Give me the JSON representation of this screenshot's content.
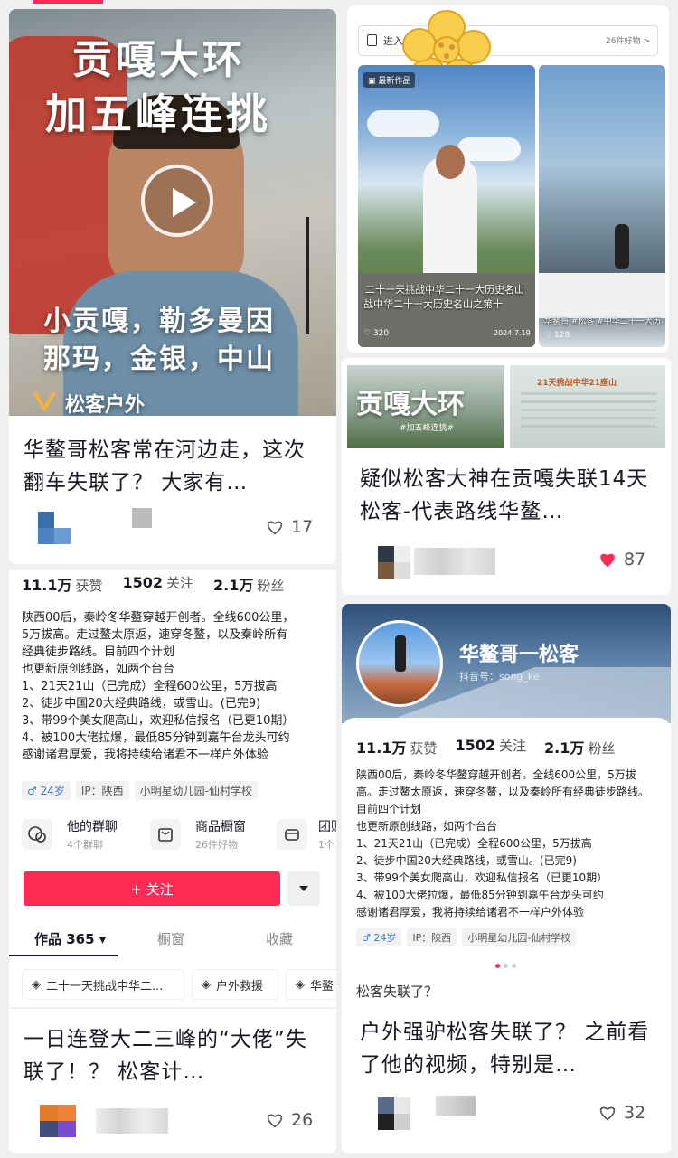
{
  "top_left_card": {
    "overlay_title_line1": "贡嘎大环",
    "overlay_title_line2": "加五峰连挑",
    "overlay_sub_line1": "小贡嘎，勒多曼因",
    "overlay_sub_line2": "那玛，金银，中山",
    "watermark": "松客户外",
    "title": "华鳌哥松客常在河边走，这次翻车失联了？ 大家有…",
    "likes": "17"
  },
  "top_right_card": {
    "search_label": "进入",
    "shop_link": "26件好物 >",
    "badge": "最新作品",
    "thumb1_caption": "二十一天挑战中华二十一大历史名山",
    "thumb1_caption2": "战中华二十一大历史名山之第十",
    "thumb1_likes": "320",
    "thumb1_date": "2024.7.19",
    "thumb2_caption": "华鳌哥 #松客 #中华二十一大历",
    "thumb2_likes": "128"
  },
  "mid_right_card": {
    "thumb1_title": "贡嘎大环",
    "thumb1_tag": "#加五峰连挑#",
    "thumb2_text": "21天挑战中华21座山",
    "title": "疑似松客大神在贡嘎失联14天 松客-代表路线华鳌…",
    "likes": "87"
  },
  "profile_left": {
    "stats": [
      {
        "value": "11.1万",
        "label": "获赞"
      },
      {
        "value": "1502",
        "label": "关注"
      },
      {
        "value": "2.1万",
        "label": "粉丝"
      }
    ],
    "bio": [
      "陕西00后，秦岭冬华鳌穿越开创者。全线600公里，",
      "5万拔高。走过鳌太原返，速穿冬鳌，以及秦岭所有",
      "经典徒步路线。目前四个计划",
      "也更新原创线路，如两个台台",
      "1、21天21山（已完成）全程600公里，5万拔高",
      "2、徒步中国20大经典路线，或雪山。(已完9)",
      "3、带99个美女爬高山，欢迎私信报名（已更10期）",
      "4、被100大佬拉爆，最低85分钟到嘉午台龙头可约",
      "感谢诸君厚爱，我将持续给诸君不一样户外体验"
    ],
    "tags": [
      "♂ 24岁",
      "IP：陕西",
      "小明星幼儿园-仙村学校"
    ],
    "features": [
      {
        "title": "他的群聊",
        "sub": "4个群聊"
      },
      {
        "title": "商品橱窗",
        "sub": "26件好物"
      },
      {
        "title": "团购",
        "sub": "1个"
      }
    ],
    "follow_label": "+ 关注",
    "tabs": [
      "作品 365 ▾",
      "橱窗",
      "收藏"
    ],
    "collections": [
      "二十一天挑战中华二...",
      "户外救援",
      "华鳌"
    ]
  },
  "profile_right": {
    "name": "华鳌哥一松客",
    "douyin_id": "抖音号：song_ke",
    "stats": [
      {
        "value": "11.1万",
        "label": "获赞"
      },
      {
        "value": "1502",
        "label": "关注"
      },
      {
        "value": "2.1万",
        "label": "粉丝"
      }
    ],
    "bio": [
      "陕西00后，秦岭冬华鳌穿越开创者。全线600公里，5万拔",
      "高。走过鳌太原返，速穿冬鳌，以及秦岭所有经典徒步路线。",
      "目前四个计划",
      "也更新原创线路，如两个台台",
      "1、21天21山（已完成）全程600公里，5万拔高",
      "2、徒步中国20大经典路线，或雪山。(已完9)",
      "3、带99个美女爬高山，欢迎私信报名（已更10期）",
      "4、被100大佬拉爆，最低85分钟到嘉午台龙头可约",
      "感谢诸君厚爱，我将持续给诸君不一样户外体验"
    ],
    "tags": [
      "♂ 24岁",
      "IP：陕西",
      "小明星幼儿园-仙村学校"
    ],
    "subtitle": "松客失联了？",
    "title": "户外强驴松客失联了？ 之前看了他的视频，特别是…",
    "likes": "32"
  },
  "bottom_left_card": {
    "title": "一日连登大二三峰的“大佬”失联了！？ 松客计…",
    "likes": "26"
  },
  "colors": {
    "accent": "#fe2c55",
    "text": "#161823"
  }
}
